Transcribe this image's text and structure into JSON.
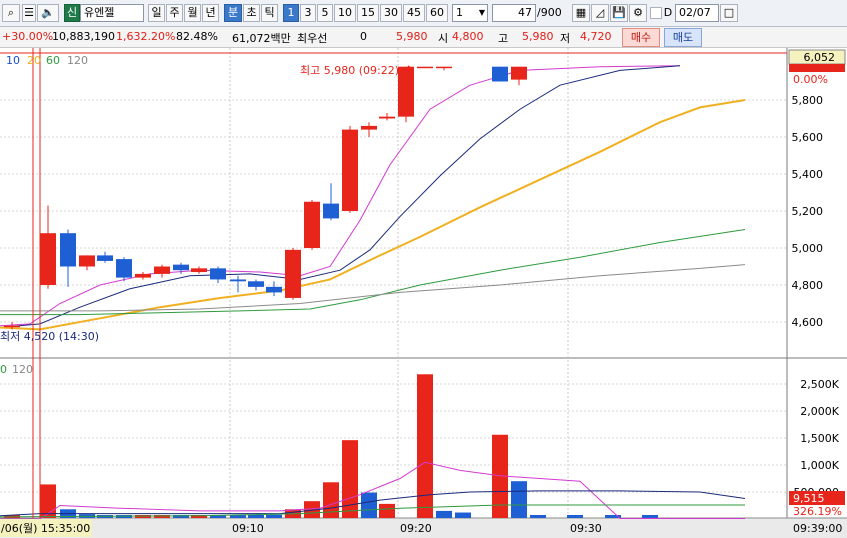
{
  "toolbar": {
    "stock_badge": "신",
    "stock_name": "유엔젤",
    "periods": [
      "일",
      "주",
      "월",
      "년"
    ],
    "intervals": [
      "분",
      "초",
      "틱"
    ],
    "minutes": [
      "1",
      "3",
      "5",
      "10",
      "15",
      "30",
      "45",
      "60"
    ],
    "minute_value": "1",
    "count_value": "47",
    "count_total": "/900",
    "d_label": "D",
    "date_value": "02/07"
  },
  "info": {
    "change_pct": "+30.00%",
    "volume": "10,883,190",
    "volume_pct": "1,632.20%",
    "ratio": "82.48%",
    "amount": "61,072백만",
    "pref_label": "최우선",
    "pref_value": "0",
    "price": "5,980",
    "open_label": "시",
    "open": "4,800",
    "high_label": "고",
    "high": "5,980",
    "low_label": "저",
    "low": "4,720",
    "buy_label": "매수",
    "sell_label": "매도"
  },
  "price_chart": {
    "ma_legend": [
      "10",
      "20",
      "60",
      "120"
    ],
    "high_annot": "최고 5,980 (09:22)",
    "low_annot": "최저 4,520 (14:30)",
    "y_ticks": [
      "5,800",
      "5,600",
      "5,400",
      "5,200",
      "5,000",
      "4,800",
      "4,600"
    ],
    "cur_price_box": "6,052",
    "cur_pct": "0.00%",
    "colors": {
      "up": "#e8251b",
      "down": "#1f5fd4",
      "ma10": "#d33ad0",
      "ma20": "#1a2a7a",
      "ma60": "#f0b020",
      "ma120": "#2e9a3e"
    }
  },
  "volume_chart": {
    "ma_legend": [
      "0",
      "120"
    ],
    "y_ticks": [
      "2,500K",
      "2,000K",
      "1,500K",
      "1,000K",
      "500,000"
    ],
    "cur_volume_box": "9,515",
    "cur_pct": "326.19%"
  },
  "time_axis": {
    "start_label": "/06(월) 15:35:00",
    "ticks": [
      "09:10",
      "09:20",
      "09:30"
    ],
    "end_label": "09:39:00"
  },
  "chart_data": {
    "type": "bar",
    "candles": [
      {
        "t": "15:35",
        "o": 4580,
        "h": 4600,
        "l": 4560,
        "c": 4580
      },
      {
        "t": "09:00",
        "o": 4800,
        "h": 5230,
        "l": 4780,
        "c": 5080
      },
      {
        "t": "09:01",
        "o": 5080,
        "h": 5100,
        "l": 4790,
        "c": 4900
      },
      {
        "t": "09:02",
        "o": 4900,
        "h": 4960,
        "l": 4880,
        "c": 4960
      },
      {
        "t": "09:03",
        "o": 4960,
        "h": 4980,
        "l": 4920,
        "c": 4930
      },
      {
        "t": "09:04",
        "o": 4940,
        "h": 4950,
        "l": 4820,
        "c": 4840
      },
      {
        "t": "09:05",
        "o": 4840,
        "h": 4870,
        "l": 4830,
        "c": 4860
      },
      {
        "t": "09:06",
        "o": 4860,
        "h": 4910,
        "l": 4840,
        "c": 4900
      },
      {
        "t": "09:07",
        "o": 4910,
        "h": 4920,
        "l": 4860,
        "c": 4880
      },
      {
        "t": "09:08",
        "o": 4870,
        "h": 4900,
        "l": 4860,
        "c": 4890
      },
      {
        "t": "09:09",
        "o": 4890,
        "h": 4900,
        "l": 4810,
        "c": 4830
      },
      {
        "t": "09:10",
        "o": 4830,
        "h": 4850,
        "l": 4760,
        "c": 4820
      },
      {
        "t": "09:11",
        "o": 4820,
        "h": 4830,
        "l": 4770,
        "c": 4790
      },
      {
        "t": "09:12",
        "o": 4790,
        "h": 4820,
        "l": 4740,
        "c": 4760
      },
      {
        "t": "09:13",
        "o": 4730,
        "h": 5000,
        "l": 4720,
        "c": 4990
      },
      {
        "t": "09:14",
        "o": 5000,
        "h": 5260,
        "l": 4990,
        "c": 5250
      },
      {
        "t": "09:15",
        "o": 5240,
        "h": 5350,
        "l": 5150,
        "c": 5160
      },
      {
        "t": "09:16",
        "o": 5200,
        "h": 5660,
        "l": 5190,
        "c": 5640
      },
      {
        "t": "09:17",
        "o": 5640,
        "h": 5680,
        "l": 5600,
        "c": 5660
      },
      {
        "t": "09:18",
        "o": 5700,
        "h": 5730,
        "l": 5690,
        "c": 5710
      },
      {
        "t": "09:19",
        "o": 5710,
        "h": 5980,
        "l": 5680,
        "c": 5980
      },
      {
        "t": "09:20",
        "o": 5980,
        "h": 5980,
        "l": 5980,
        "c": 5980
      },
      {
        "t": "09:21",
        "o": 5980,
        "h": 5980,
        "l": 5960,
        "c": 5980
      },
      {
        "t": "09:22",
        "o": 5980,
        "h": 5980,
        "l": 5900,
        "c": 5900
      },
      {
        "t": "09:23",
        "o": 5910,
        "h": 5980,
        "l": 5880,
        "c": 5980
      }
    ],
    "volumes": [
      20000,
      640000,
      180000,
      90000,
      60000,
      70000,
      40000,
      30000,
      20000,
      30000,
      50000,
      60000,
      60000,
      80000,
      180000,
      330000,
      680000,
      1460000,
      490000,
      280000,
      2680000,
      150000,
      120000,
      1560000,
      700000,
      60000,
      30000,
      20000,
      10000
    ]
  }
}
